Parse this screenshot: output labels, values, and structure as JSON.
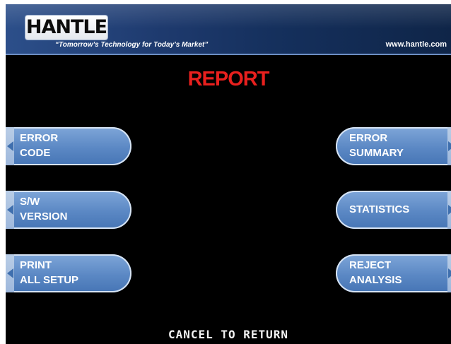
{
  "header": {
    "logo": "HANTLE",
    "tagline": "“Tomorrow’s Technology for Today’s Market”",
    "website": "www.hantle.com"
  },
  "title": "REPORT",
  "colors": {
    "title": "#e8201e",
    "key_fill": "#5b88c4",
    "header": "#1e3a6e",
    "background": "#000000"
  },
  "left_keys": [
    {
      "line1": "ERROR",
      "line2": "CODE"
    },
    {
      "line1": "S/W",
      "line2": "VERSION"
    },
    {
      "line1": "PRINT",
      "line2": "ALL SETUP"
    }
  ],
  "right_keys": [
    {
      "line1": "ERROR",
      "line2": "SUMMARY"
    },
    {
      "line1": "STATISTICS"
    },
    {
      "line1": "REJECT",
      "line2": "ANALYSIS"
    }
  ],
  "footer": {
    "cancel": "CANCEL TO RETURN"
  }
}
